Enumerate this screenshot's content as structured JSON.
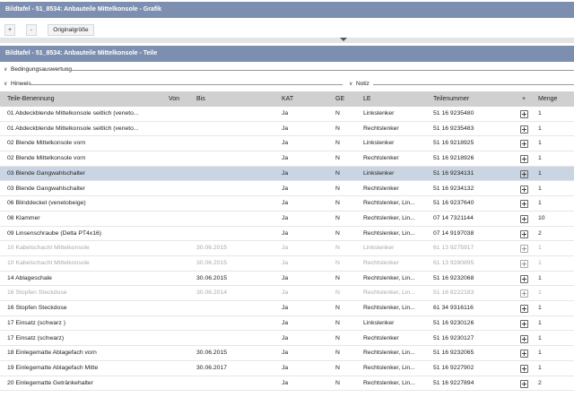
{
  "graphic_panel": {
    "title": "Bildtafel - 51_8534: Anbauteile Mittelkonsole - Grafik"
  },
  "toolbar": {
    "zoom_in": "+",
    "zoom_out": "-",
    "original_size": "Originalgröße"
  },
  "parts_panel": {
    "title": "Bildtafel - 51_8534: Anbauteile Mittelkonsole - Teile"
  },
  "sections": {
    "conditions": "Bedingungsauswertung",
    "hint": "Hinweis",
    "note": "Notiz"
  },
  "table": {
    "headers": {
      "name": "Teile-Benennung",
      "from": "Von",
      "to": "Bis",
      "kat": "KAT",
      "ge": "GE",
      "le": "LE",
      "partno": "Teilenummer",
      "plus": "+",
      "qty": "Menge"
    },
    "rows": [
      {
        "name": "01 Abdeckblende Mittelkonsole seitlich (veneto...",
        "from": "",
        "to": "",
        "kat": "Ja",
        "ge": "N",
        "le": "Linkslenker",
        "partno": "51 16 9235480",
        "qty": "1",
        "state": "normal"
      },
      {
        "name": "01 Abdeckblende Mittelkonsole seitlich (veneto...",
        "from": "",
        "to": "",
        "kat": "Ja",
        "ge": "N",
        "le": "Rechtslenker",
        "partno": "51 16 9235483",
        "qty": "1",
        "state": "normal"
      },
      {
        "name": "02 Blende Mittelkonsole vorn",
        "from": "",
        "to": "",
        "kat": "Ja",
        "ge": "N",
        "le": "Linkslenker",
        "partno": "51 16 9218925",
        "qty": "1",
        "state": "normal"
      },
      {
        "name": "02 Blende Mittelkonsole vorn",
        "from": "",
        "to": "",
        "kat": "Ja",
        "ge": "N",
        "le": "Rechtslenker",
        "partno": "51 16 9218926",
        "qty": "1",
        "state": "normal"
      },
      {
        "name": "03 Blende Gangwahlschalter",
        "from": "",
        "to": "",
        "kat": "Ja",
        "ge": "N",
        "le": "Linkslenker",
        "partno": "51 16 9234131",
        "qty": "1",
        "state": "selected"
      },
      {
        "name": "03 Blende Gangwahlschalter",
        "from": "",
        "to": "",
        "kat": "Ja",
        "ge": "N",
        "le": "Rechtslenker",
        "partno": "51 16 9234132",
        "qty": "1",
        "state": "normal"
      },
      {
        "name": "06 Blinddeckel (venetobeige)",
        "from": "",
        "to": "",
        "kat": "Ja",
        "ge": "N",
        "le": "Rechtslenker, Lin...",
        "partno": "51 16 9237640",
        "qty": "1",
        "state": "normal"
      },
      {
        "name": "08 Klammer",
        "from": "",
        "to": "",
        "kat": "Ja",
        "ge": "N",
        "le": "Rechtslenker, Lin...",
        "partno": "07 14 7321144",
        "qty": "10",
        "state": "normal"
      },
      {
        "name": "09 Linsenschraube (Delta PT4x16)",
        "from": "",
        "to": "",
        "kat": "Ja",
        "ge": "N",
        "le": "Rechtslenker, Lin...",
        "partno": "07 14 9197038",
        "qty": "2",
        "state": "normal"
      },
      {
        "name": "10 Kabelschacht Mittelkonsole",
        "from": "",
        "to": "30.06.2015",
        "kat": "Ja",
        "ge": "N",
        "le": "Linkslenker",
        "partno": "61 13 9275917",
        "qty": "1",
        "state": "disabled"
      },
      {
        "name": "10 Kabelschacht Mittelkonsole",
        "from": "",
        "to": "30.06.2015",
        "kat": "Ja",
        "ge": "N",
        "le": "Rechtslenker",
        "partno": "61 13 9280895",
        "qty": "1",
        "state": "disabled"
      },
      {
        "name": "14 Ablageschale",
        "from": "",
        "to": "30.06.2015",
        "kat": "Ja",
        "ge": "N",
        "le": "Rechtslenker, Lin...",
        "partno": "51 16 9232068",
        "qty": "1",
        "state": "normal"
      },
      {
        "name": "16 Stopfen Steckdose",
        "from": "",
        "to": "30.06.2014",
        "kat": "Ja",
        "ge": "N",
        "le": "Rechtslenker, Lin...",
        "partno": "51 16 8222183",
        "qty": "1",
        "state": "disabled"
      },
      {
        "name": "16 Stopfen Steckdose",
        "from": "",
        "to": "",
        "kat": "Ja",
        "ge": "N",
        "le": "Rechtslenker, Lin...",
        "partno": "61 34 9316116",
        "qty": "1",
        "state": "normal"
      },
      {
        "name": "17 Einsatz (schwarz )",
        "from": "",
        "to": "",
        "kat": "Ja",
        "ge": "N",
        "le": "Linkslenker",
        "partno": "51 16 9230126",
        "qty": "1",
        "state": "normal"
      },
      {
        "name": "17 Einsatz (schwarz)",
        "from": "",
        "to": "",
        "kat": "Ja",
        "ge": "N",
        "le": "Rechtslenker",
        "partno": "51 16 9230127",
        "qty": "1",
        "state": "normal"
      },
      {
        "name": "18 Einlegematte Ablagefach vorn",
        "from": "",
        "to": "30.06.2015",
        "kat": "Ja",
        "ge": "N",
        "le": "Rechtslenker, Lin...",
        "partno": "51 16 9232065",
        "qty": "1",
        "state": "normal"
      },
      {
        "name": "19 Einlegematte Ablagefach Mitte",
        "from": "",
        "to": "30.06.2017",
        "kat": "Ja",
        "ge": "N",
        "le": "Rechtslenker, Lin...",
        "partno": "51 16 9227902",
        "qty": "1",
        "state": "normal"
      },
      {
        "name": "20 Einlegematte Getränkehalter",
        "from": "",
        "to": "",
        "kat": "Ja",
        "ge": "N",
        "le": "Rechtslenker, Lin...",
        "partno": "51 16 9227894",
        "qty": "2",
        "state": "normal"
      }
    ]
  },
  "colors": {
    "titlebar": "#7d8fb0",
    "selected_row": "#c9d5e3",
    "header_bg": "#d0d0d0"
  }
}
